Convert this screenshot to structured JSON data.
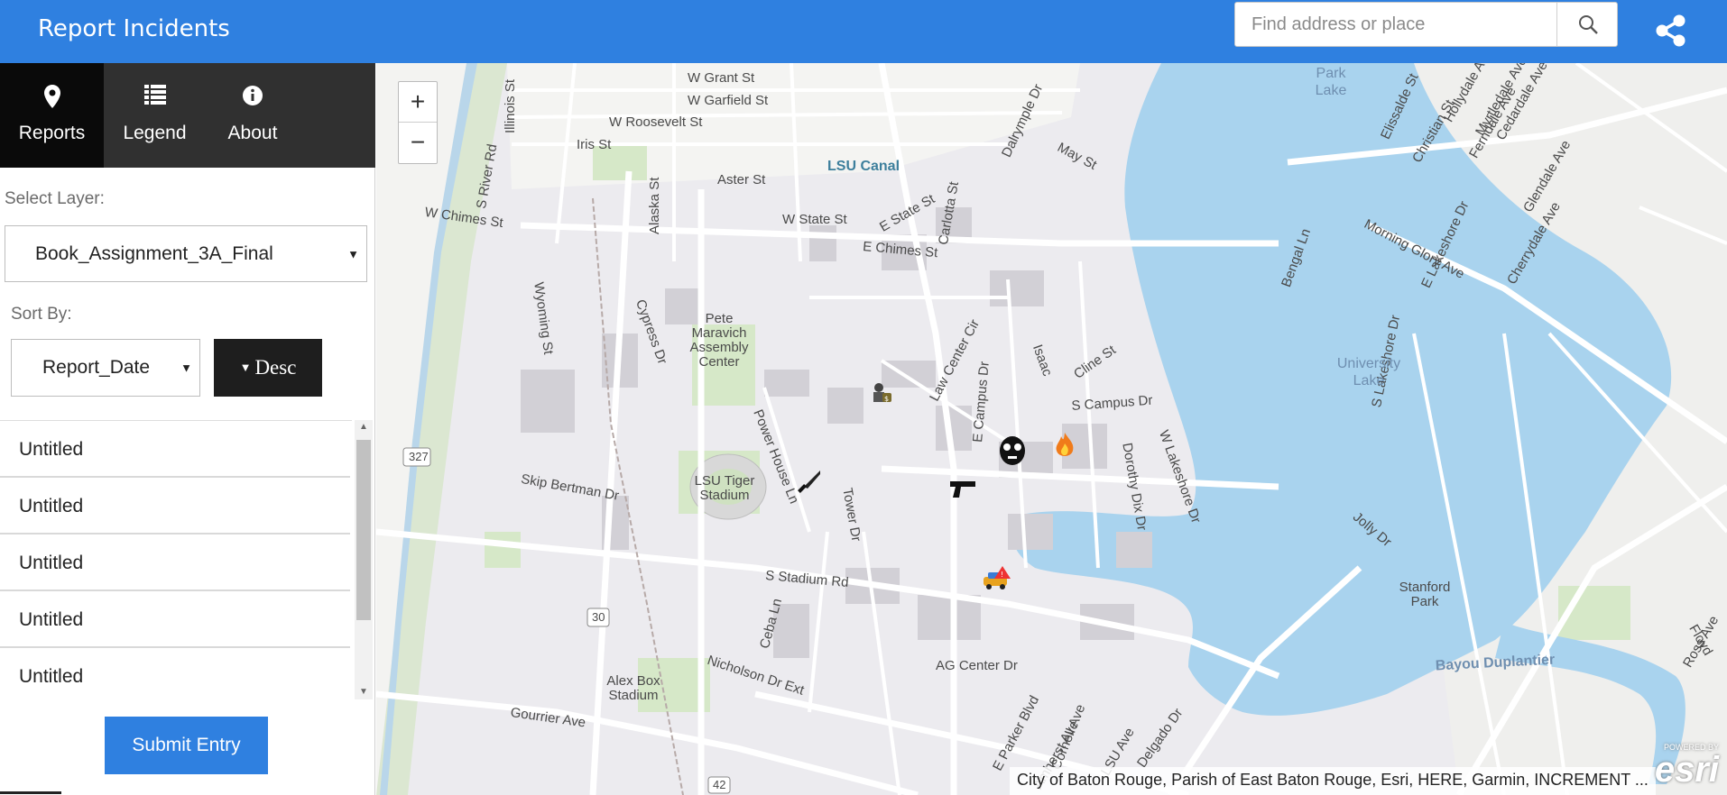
{
  "header": {
    "title": "Report Incidents",
    "search_placeholder": "Find address or place"
  },
  "tabs": [
    {
      "label": "Reports",
      "icon": "map-pin-icon",
      "active": true
    },
    {
      "label": "Legend",
      "icon": "list-icon",
      "active": false
    },
    {
      "label": "About",
      "icon": "info-icon",
      "active": false
    }
  ],
  "panel": {
    "select_layer_label": "Select Layer:",
    "layer_value": "Book_Assignment_3A_Final",
    "sort_by_label": "Sort By:",
    "sort_value": "Report_Date",
    "sort_order": "Desc",
    "items": [
      "Untitled",
      "Untitled",
      "Untitled",
      "Untitled",
      "Untitled"
    ],
    "submit_label": "Submit Entry"
  },
  "map": {
    "zoom_in": "+",
    "zoom_out": "−",
    "streets": [
      "W Grant St",
      "W Garfield St",
      "W Roosevelt St",
      "Iris St",
      "Aster St",
      "W Chimes St",
      "S River Rd",
      "Wyoming St",
      "Illinois St",
      "Alaska St",
      "Cypress Dr",
      "W State St",
      "E State St",
      "E Chimes St",
      "Carlotta St",
      "Dalrymple Dr",
      "May St",
      "Morning Glory Ave",
      "Myrtledale Ave",
      "Cherrydale Ave",
      "Bengal Ln",
      "E Lakeshore Dr",
      "S Lakeshore Dr",
      "Dorothy Dix Dr",
      "W Lakeshore Dr",
      "Law Center Cir",
      "E Campus Dr",
      "Isaac",
      "Cline St",
      "S Campus Dr",
      "Skip Bertman Dr",
      "Power House Ln",
      "Tower Dr",
      "S Stadium Rd",
      "Ceba Ln",
      "Nicholson Dr Ext",
      "AG Center Dr",
      "E Parker Blvd",
      "Gourrier Ave",
      "Cornell Ave",
      "LSU Ave",
      "Delgado Dr",
      "Amherst Ave",
      "Jolly Dr",
      "Ross Ave",
      "Floyd",
      "Elissalde St",
      "Christian St",
      "Hollydale Ave",
      "Ferndale Ave",
      "Cedardale Ave",
      "Glendale Ave"
    ],
    "places": [
      "LSU Canal",
      "Pete Maravich Assembly Center",
      "LSU Tiger Stadium",
      "Alex Box Stadium",
      "Stanford Park"
    ],
    "water": [
      "Park Lake",
      "University Lake",
      "Bayou Duplantier"
    ],
    "shields": [
      "327",
      "30",
      "42"
    ],
    "attribution": "City of Baton Rouge, Parish of East Baton Rouge, Esri, HERE, Garmin, INCREMENT ...",
    "logo_small": "POWERED BY",
    "logo": "esri",
    "markers": [
      "robbery-icon",
      "mask-icon",
      "fire-icon",
      "gun-icon",
      "knife-icon",
      "car-accident-icon"
    ]
  },
  "colors": {
    "header": "#2f80e0",
    "tab_bar": "#303030",
    "tab_active": "#0a0a0a",
    "map_land": "#ecebef",
    "water": "#a9d3ee",
    "park": "#d6e8c8"
  }
}
